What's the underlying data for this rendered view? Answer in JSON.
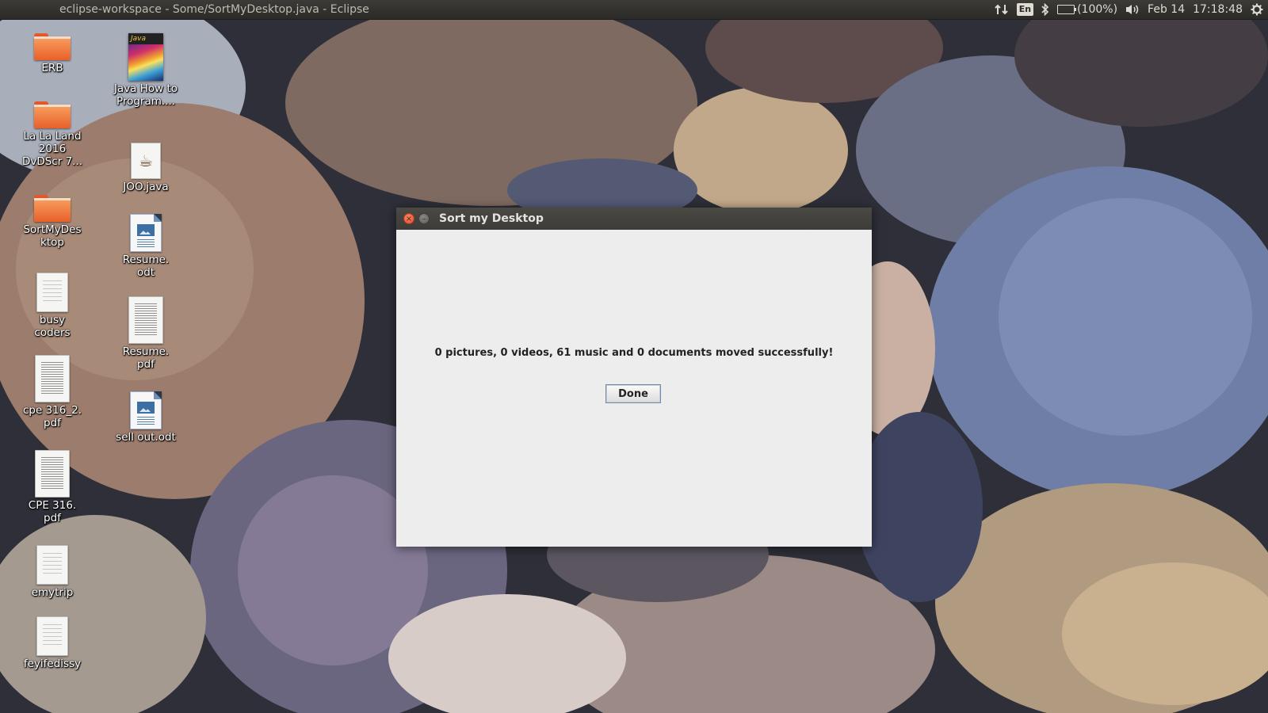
{
  "panel": {
    "window_title": "eclipse-workspace - Some/SortMyDesktop.java - Eclipse",
    "language": "En",
    "battery": "(100%)",
    "date": "Feb 14",
    "time": "17:18:48"
  },
  "desktop": {
    "icons": [
      {
        "label": "ERB"
      },
      {
        "label": "La La Land 2016 DvDScr 7..."
      },
      {
        "label": "SortMyDesktop"
      },
      {
        "label": "busy coders"
      },
      {
        "label": "cpe 316_2. pdf"
      },
      {
        "label": "CPE 316. pdf"
      },
      {
        "label": "emytrip"
      },
      {
        "label": "feyifedissy"
      },
      {
        "label": "Java How to Program...."
      },
      {
        "label": "JOO.java"
      },
      {
        "label": "Resume. odt"
      },
      {
        "label": "Resume. pdf"
      },
      {
        "label": "sell out.odt"
      }
    ],
    "java_book_cover_text": "Java"
  },
  "dialog": {
    "title": "Sort my Desktop",
    "message": "0 pictures, 0 videos, 61 music and 0 documents moved successfully!",
    "done_label": "Done",
    "close_glyph": "×",
    "minimize_glyph": "–"
  },
  "colors": {
    "panel_bg": "#3c3b37",
    "titlebar_bg": "#45443f",
    "dialog_bg": "#ededed",
    "folder_orange": "#e8602a"
  }
}
